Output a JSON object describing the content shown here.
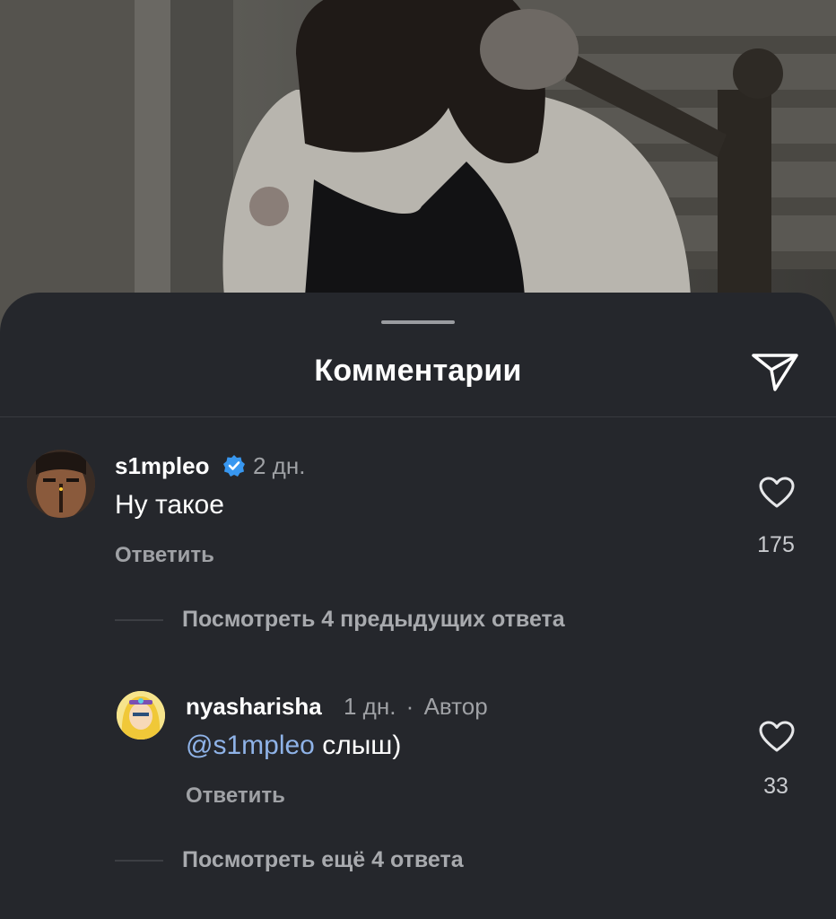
{
  "sheet": {
    "title": "Комментарии",
    "share_icon": "send-icon"
  },
  "comments": [
    {
      "username": "s1mpleo",
      "verified": true,
      "time": "2 дн.",
      "text": "Ну такое",
      "reply_label": "Ответить",
      "likes": "175",
      "view_replies": "Посмотреть 4 предыдущих ответа"
    }
  ],
  "replies": [
    {
      "username": "nyasharisha",
      "time": "1 дн.",
      "separator": "·",
      "author_badge": "Автор",
      "mention": "@s1mpleo",
      "text": " слыш)",
      "reply_label": "Ответить",
      "likes": "33",
      "view_more": "Посмотреть ещё 4 ответа"
    }
  ],
  "colors": {
    "sheet_bg": "#25272c",
    "verified_badge": "#3897f0",
    "mention": "#8fb3e8"
  }
}
